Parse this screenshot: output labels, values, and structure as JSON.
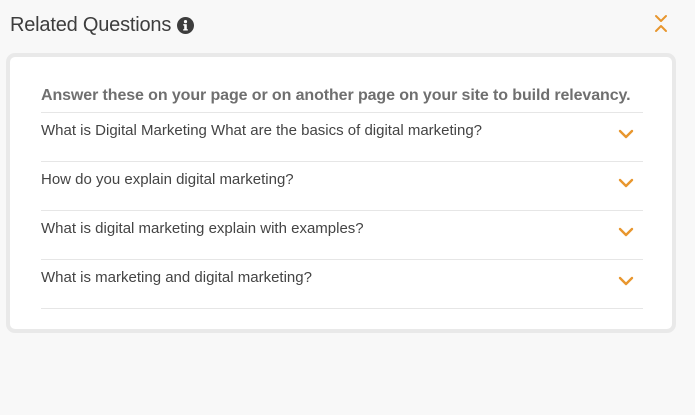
{
  "header": {
    "title": "Related Questions",
    "info_icon": "info-circle-icon",
    "collapse_icon": "collapse-chevrons-icon"
  },
  "panel": {
    "intro": "Answer these on your page or on another page on your site to build relevancy.",
    "questions": [
      {
        "text": "What is Digital Marketing What are the basics of digital marketing?",
        "icon": "chevron-down-icon"
      },
      {
        "text": "How do you explain digital marketing?",
        "icon": "chevron-down-icon"
      },
      {
        "text": "What is digital marketing explain with examples?",
        "icon": "chevron-down-icon"
      },
      {
        "text": "What is marketing and digital marketing?",
        "icon": "chevron-down-icon"
      }
    ]
  },
  "colors": {
    "accent": "#e8962e",
    "title_text": "#3d3d3d",
    "intro_text": "#6f6f6f",
    "question_text": "#444444",
    "divider": "#e6e6e6",
    "background": "#f8f8f8"
  }
}
